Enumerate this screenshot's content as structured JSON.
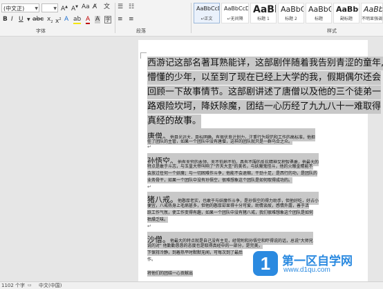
{
  "ribbon": {
    "font_name": "(中文正)",
    "font_size": "",
    "font_group_label": "字体",
    "paragraph_group_label": "段落",
    "styles_group_label": "样式",
    "styles": [
      {
        "sample": "AaBbCcDd",
        "name": "↵正文"
      },
      {
        "sample": "AaBbCcDd",
        "name": "↵无间隔"
      },
      {
        "sample": "AaBl",
        "name": "标题 1"
      },
      {
        "sample": "AaBbC",
        "name": "标题 2"
      },
      {
        "sample": "AaBbC",
        "name": "标题"
      },
      {
        "sample": "AaBbC",
        "name": "副标题"
      },
      {
        "sample": "AaBbC",
        "name": "不明显强调"
      }
    ]
  },
  "doc": {
    "intro": [
      "西游记这部名著耳熟能详，这部剧伴随着我告别青涩的童年,",
      "懵懂的少年，以至到了现在已经上大学的我，假期偶尔还会",
      "回顾一下故事情节。这部剧讲述了唐僧以及他的三个徒弟一",
      "路艰险坎坷，降妖除魔，团结一心历经了九九八十一难取得",
      "真经的故事。"
    ],
    "sections": [
      {
        "head": "唐僧。",
        "lines": [
          "他目光远大，目标明确，有很优良计划力，注重行为规范和工作的高标准，他担",
          "任了团队的主管，如果一个团队中没有唐僧，这样的团队就只是一群乌合之众。"
        ]
      },
      {
        "head": "孙悟空。",
        "lines": [
          "他有无穷的本领，天不怕地不怕，具有不服的反抗精神又积智勇敢，他最大的",
          "特点是敢于斗志，与玉皇大帝叫响了\"齐天大圣\"的美名，与妖魔鬼怪斗，他的火眼金睛能不",
          "会放过任何一个妖魔；与一切困难作斗争，他能不会退缩，干劲十足，是西行的功，是团队的",
          "业务骨干，如果一个团队中没有孙悟空，很难想象这个团队是如何取得成功的。"
        ]
      },
      {
        "head": "猪八戒。",
        "lines": [
          "他憨厚老实，也敢于与妖魔作斗争，是孙悟空的得力助手，但他好吃，好占小",
          "便宜，八戒热身上毛病甚多，但他的憨厚却显得十分可爱，助情谈故，感情外露，善于活",
          "跃工作气氛，使工作变得有趣，如果一个团队中没有猪八戒，我们很难想象这个团队是如何",
          "枯燥乏味。"
        ]
      },
      {
        "head": "沙僧。",
        "lines": [
          "他最大的特点就是自己没有主见，经常附和孙悟空和吓得说的话，总说\"大师兄",
          "说的对\" 他勤勤恳恳的态度也是取得真经中的一部分，是完美，"
        ]
      }
    ],
    "fragment1": "下保持冷静，到着热平时默默无闻，可每次到了最后",
    "fragment2": "将他们的团结一心贡献出重要的团队，但在最后一难中受到了，重要的",
    "fragment3": "作。",
    "bottom_line": "将他们的团结一心贡献出"
  },
  "status": {
    "words": "1102 个字",
    "language": "中文(中国)"
  },
  "watermark": {
    "logo_char": "1",
    "title": "第一区自学网",
    "url": "www.d1qu.com",
    "brand_color": "#2b8ae0"
  }
}
